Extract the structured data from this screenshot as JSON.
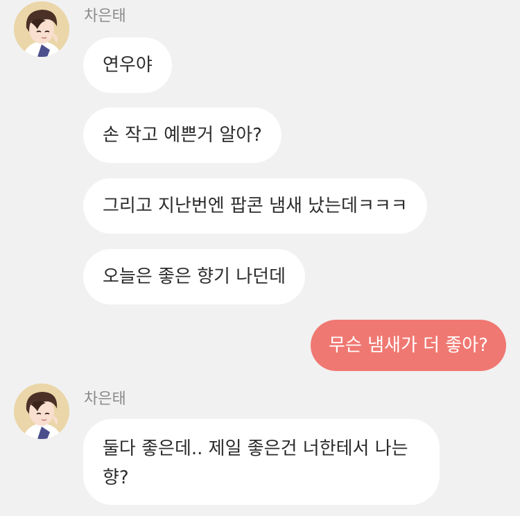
{
  "conversation": {
    "groups": [
      {
        "sender": "차은태",
        "messages": [
          "연우야",
          "손 작고 예쁜거 알아?",
          "그리고 지난번엔 팝콘 냄새 났는데ㅋㅋㅋ",
          "오늘은 좋은 향기 나던데"
        ]
      },
      {
        "outgoing": "무슨 냄새가 더 좋아?"
      },
      {
        "sender": "차은태",
        "messages": [
          "둘다 좋은데.. 제일 좋은건 너한테서 나는 향?"
        ]
      }
    ]
  },
  "colors": {
    "background": "#f1f1f1",
    "incoming_bubble": "#ffffff",
    "outgoing_bubble": "#f07872",
    "sender_name": "#8a8a8a"
  },
  "icons": {
    "avatar": "profile-avatar-illustration"
  }
}
